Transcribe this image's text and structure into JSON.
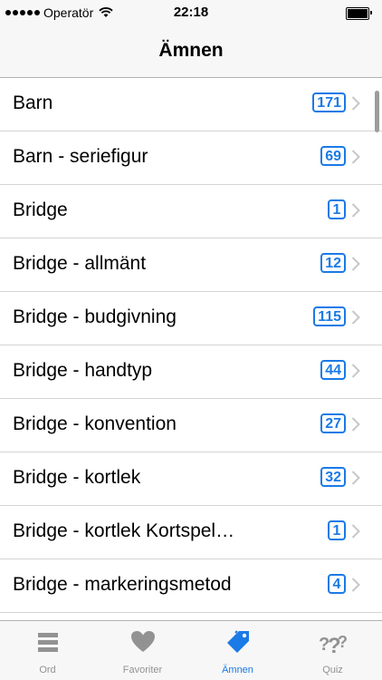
{
  "status_bar": {
    "carrier": "Operatör",
    "time": "22:18"
  },
  "nav": {
    "title": "Ämnen"
  },
  "topics": [
    {
      "label": "Barn",
      "count": "171"
    },
    {
      "label": "Barn - seriefigur",
      "count": "69"
    },
    {
      "label": "Bridge",
      "count": "1"
    },
    {
      "label": "Bridge - allmänt",
      "count": "12"
    },
    {
      "label": "Bridge - budgivning",
      "count": "115"
    },
    {
      "label": "Bridge - handtyp",
      "count": "44"
    },
    {
      "label": "Bridge - konvention",
      "count": "27"
    },
    {
      "label": "Bridge - kortlek",
      "count": "32"
    },
    {
      "label": "Bridge - kortlek Kortspel…",
      "count": "1"
    },
    {
      "label": "Bridge - markeringsmetod",
      "count": "4"
    },
    {
      "label": "",
      "count": ""
    }
  ],
  "tabs": [
    {
      "label": "Ord",
      "icon": "list-icon",
      "active": false
    },
    {
      "label": "Favoriter",
      "icon": "heart-icon",
      "active": false
    },
    {
      "label": "Ämnen",
      "icon": "tag-icon",
      "active": true
    },
    {
      "label": "Quiz",
      "icon": "question-icon",
      "active": false
    }
  ],
  "colors": {
    "accent": "#1a7ae6",
    "inactive": "#929292",
    "bar_bg": "#f7f7f7"
  }
}
